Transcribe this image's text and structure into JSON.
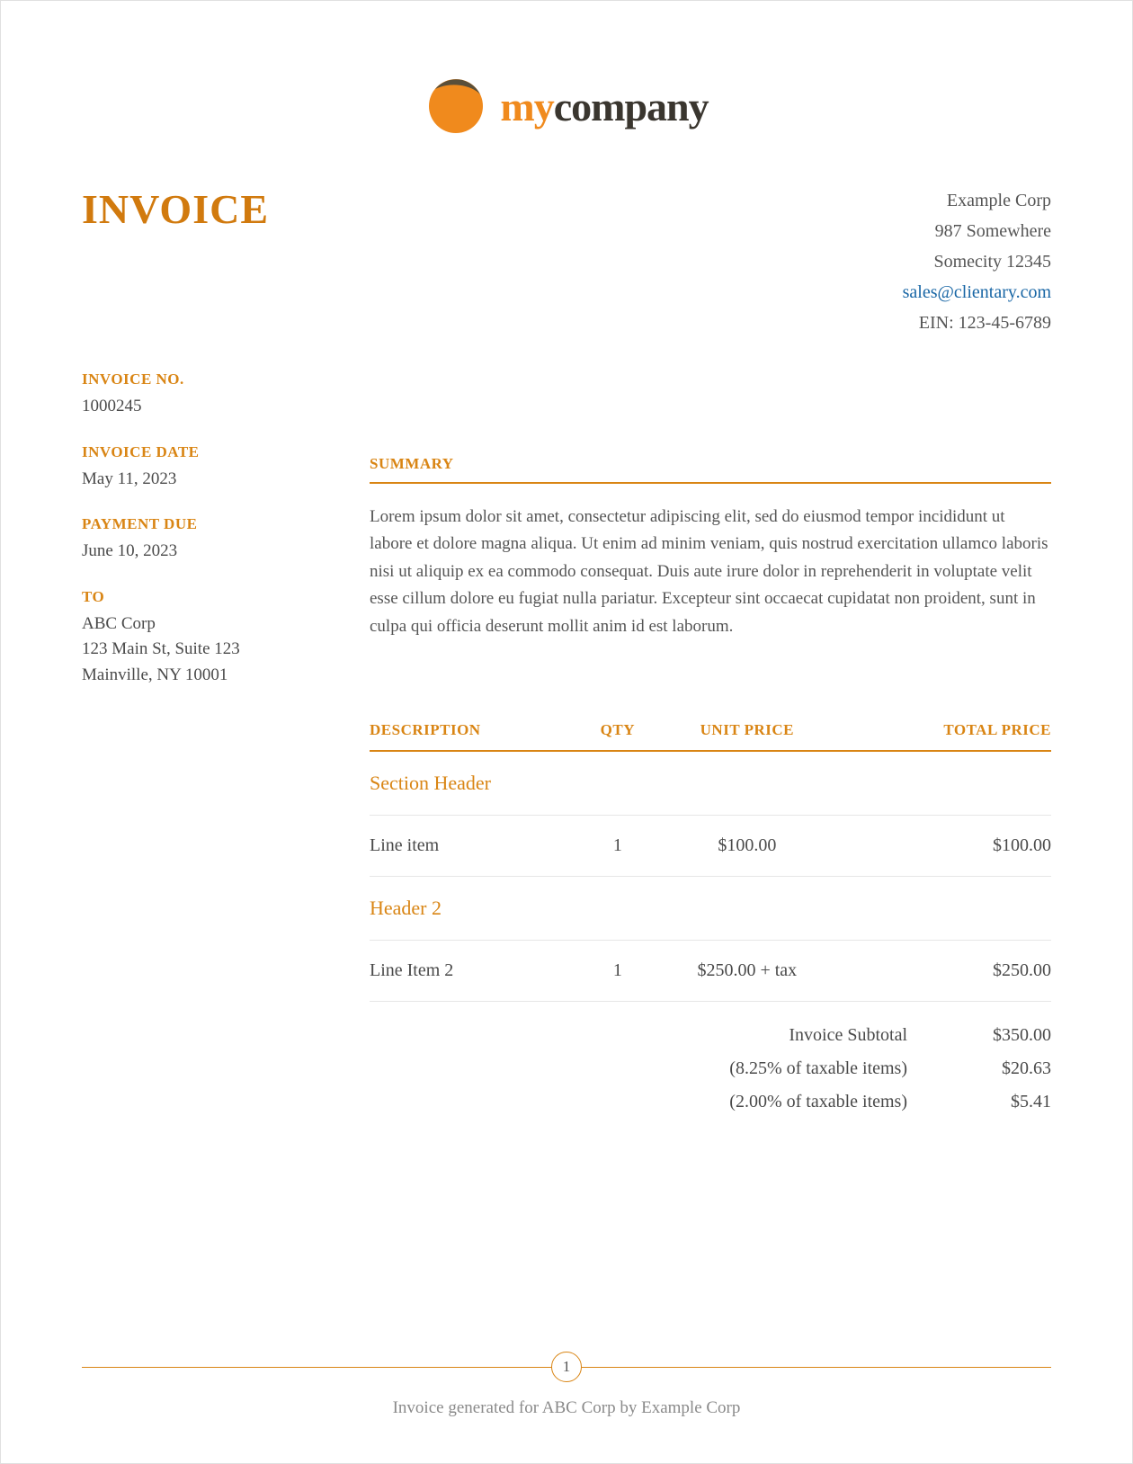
{
  "logo": {
    "my": "my",
    "company": "company"
  },
  "doc_title": "INVOICE",
  "company": {
    "name": "Example Corp",
    "street": "987 Somewhere",
    "city": "Somecity 12345",
    "email": "sales@clientary.com",
    "ein": "EIN: 123-45-6789"
  },
  "meta": {
    "invoice_no_label": "INVOICE NO.",
    "invoice_no": "1000245",
    "invoice_date_label": "INVOICE DATE",
    "invoice_date": "May 11, 2023",
    "payment_due_label": "PAYMENT DUE",
    "payment_due": "June 10, 2023",
    "to_label": "TO",
    "to_name": "ABC Corp",
    "to_street": "123 Main St, Suite 123",
    "to_city": "Mainville, NY 10001"
  },
  "summary": {
    "heading": "SUMMARY",
    "text": "Lorem ipsum dolor sit amet, consectetur adipiscing elit, sed do eiusmod tempor incididunt ut labore et dolore magna aliqua. Ut enim ad minim veniam, quis nostrud exercitation ullamco laboris nisi ut aliquip ex ea commodo consequat. Duis aute irure dolor in reprehenderit in voluptate velit esse cillum dolore eu fugiat nulla pariatur. Excepteur sint occaecat cupidatat non proident, sunt in culpa qui officia deserunt mollit anim id est laborum."
  },
  "table": {
    "headers": {
      "desc": "DESCRIPTION",
      "qty": "QTY",
      "unit": "UNIT PRICE",
      "total": "TOTAL PRICE"
    },
    "rows": [
      {
        "type": "section",
        "desc": "Section Header"
      },
      {
        "type": "item",
        "desc": "Line item",
        "qty": "1",
        "unit": "$100.00",
        "total": "$100.00"
      },
      {
        "type": "section",
        "desc": "Header 2"
      },
      {
        "type": "item",
        "desc": "Line Item 2",
        "qty": "1",
        "unit": "$250.00 + tax",
        "total": "$250.00"
      }
    ]
  },
  "totals": [
    {
      "label": "Invoice Subtotal",
      "amount": "$350.00"
    },
    {
      "label": "(8.25% of taxable items)",
      "amount": "$20.63"
    },
    {
      "label": "(2.00% of taxable items)",
      "amount": "$5.41"
    }
  ],
  "footer": {
    "page": "1",
    "text": "Invoice generated for ABC Corp by Example Corp"
  }
}
